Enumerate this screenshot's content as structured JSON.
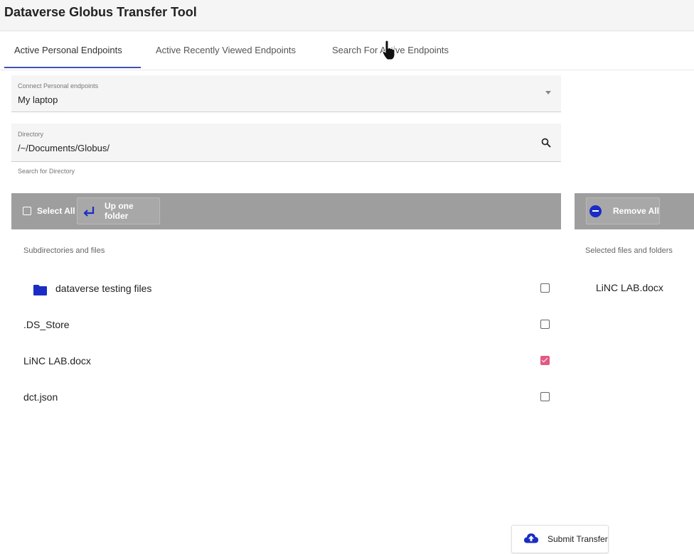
{
  "app": {
    "title": "Dataverse Globus Transfer Tool"
  },
  "tabs": [
    {
      "label": "Active Personal Endpoints",
      "active": true
    },
    {
      "label": "Active Recently Viewed Endpoints",
      "active": false
    },
    {
      "label": "Search For Active Endpoints",
      "active": false
    }
  ],
  "endpoint": {
    "label": "Connect Personal endpoints",
    "value": "My laptop"
  },
  "directory": {
    "label": "Directory",
    "value": "/~/Documents/Globus/",
    "hint": "Search for Directory"
  },
  "toolbar": {
    "select_all": "Select All",
    "up_folder": "Up one folder",
    "remove_all": "Remove All"
  },
  "files": {
    "heading": "Subdirectories and files",
    "items": [
      {
        "name": "dataverse testing files",
        "type": "folder",
        "checked": false
      },
      {
        "name": ".DS_Store",
        "type": "file",
        "checked": false
      },
      {
        "name": "LiNC LAB.docx",
        "type": "file",
        "checked": true
      },
      {
        "name": "dct.json",
        "type": "file",
        "checked": false
      }
    ]
  },
  "selected": {
    "heading": "Selected files and folders",
    "items": [
      "LiNC LAB.docx"
    ]
  },
  "submit": {
    "label": "Submit Transfer"
  },
  "colors": {
    "accent": "#3f51b5",
    "folder_icon": "#1a2cc4",
    "checkbox_checked": "#e25a84",
    "toolbar": "#9e9e9e"
  }
}
